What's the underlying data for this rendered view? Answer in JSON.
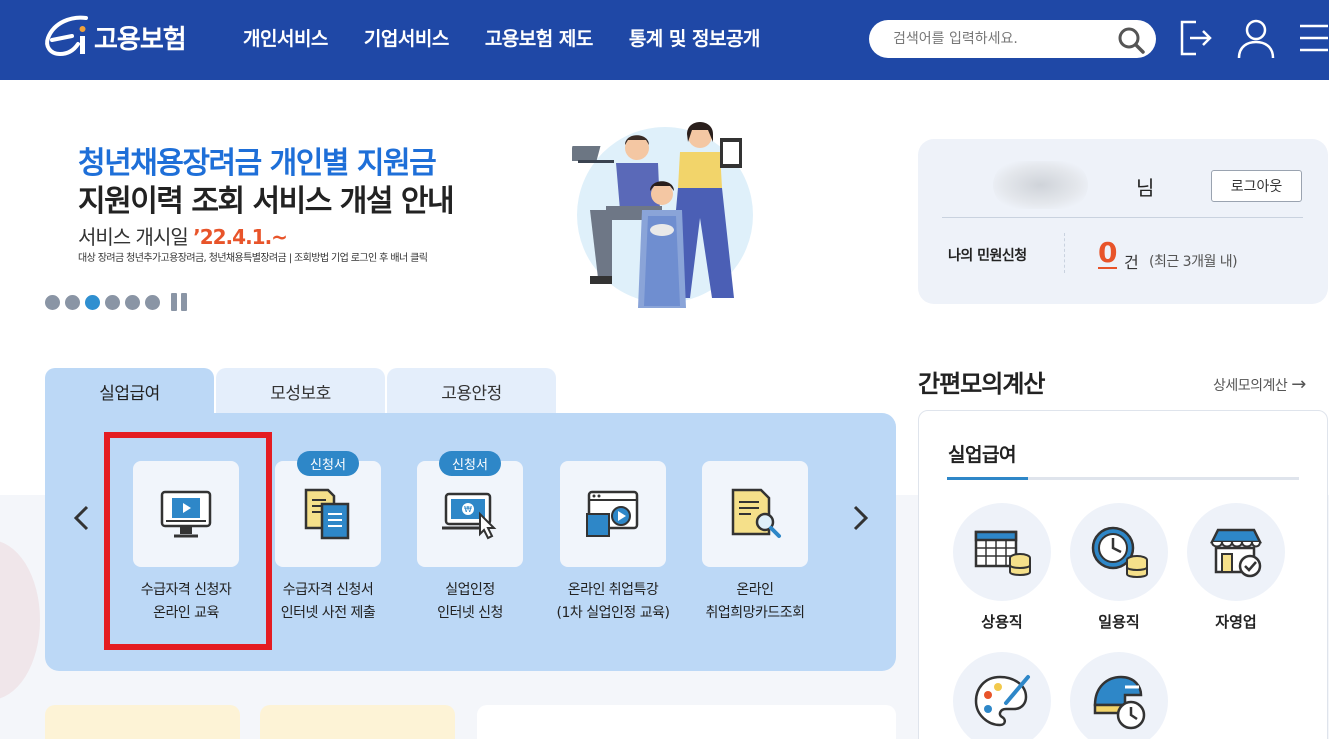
{
  "header": {
    "logo_text": "고용보험",
    "nav": [
      "개인서비스",
      "기업서비스",
      "고용보험 제도",
      "통계 및 정보공개"
    ],
    "search_placeholder": "검색어를 입력하세요."
  },
  "banner": {
    "title_line1": "청년채용장려금 개인별 지원금",
    "title_line2": "지원이력 조회 서비스 개설 안내",
    "sub_prefix": "서비스 개시일 ",
    "sub_date": "’22.4.1.~",
    "note": "대상 장려금 청년추가고용장려금, 청년채용특별장려금 | 조회방법 기업 로그인 후 배너 클릭",
    "slide_count": 6,
    "active_slide": 3
  },
  "user": {
    "honorific": "님",
    "logout_label": "로그아웃",
    "apps_label": "나의 민원신청",
    "apps_count": "0",
    "apps_unit": "건",
    "apps_period": "(최근 3개월 내)"
  },
  "tabs": [
    {
      "label": "실업급여",
      "active": true
    },
    {
      "label": "모성보호",
      "active": false
    },
    {
      "label": "고용안정",
      "active": false
    }
  ],
  "services": [
    {
      "line1": "수급자격 신청자",
      "line2": "온라인 교육",
      "badge": ""
    },
    {
      "line1": "수급자격 신청서",
      "line2": "인터넷 사전 제출",
      "badge": "신청서"
    },
    {
      "line1": "실업인정",
      "line2": "인터넷 신청",
      "badge": "신청서"
    },
    {
      "line1": "온라인 취업특강",
      "line2": "(1차 실업인정 교육)",
      "badge": ""
    },
    {
      "line1": "온라인",
      "line2": "취업희망카드조회",
      "badge": ""
    }
  ],
  "calculator": {
    "title": "간편모의계산",
    "more_label": "상세모의계산",
    "tab_label": "실업급여",
    "items": [
      {
        "label": "상용직",
        "icon": "calendar-coins-icon"
      },
      {
        "label": "일용직",
        "icon": "clock-coins-icon"
      },
      {
        "label": "자영업",
        "icon": "store-icon"
      },
      {
        "label": "",
        "icon": "palette-icon"
      },
      {
        "label": "",
        "icon": "helmet-clock-icon"
      }
    ]
  },
  "colors": {
    "header_bg": "#1f48a6",
    "accent_blue": "#1e6fd8",
    "accent_orange": "#e8542a",
    "panel_bg": "#bcd8f6",
    "highlight_red": "#e41c22"
  }
}
